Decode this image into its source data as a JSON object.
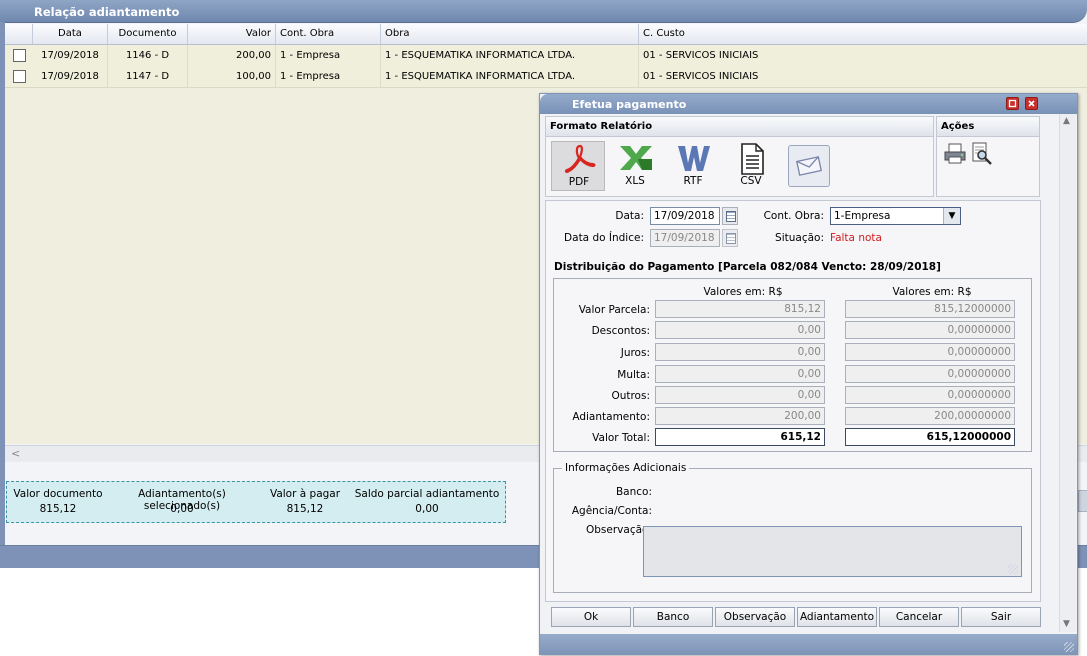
{
  "background_window": {
    "title": "Relação adiantamento",
    "columns": [
      "Data",
      "Documento",
      "Valor",
      "Cont. Obra",
      "Obra",
      "C. Custo"
    ],
    "rows": [
      {
        "data": "17/09/2018",
        "documento": "1146 - D",
        "valor": "200,00",
        "cont_obra": "1 - Empresa",
        "obra": "1 - ESQUEMATIKA INFORMATICA LTDA.",
        "c_custo": "01 - SERVICOS INICIAIS"
      },
      {
        "data": "17/09/2018",
        "documento": "1147 - D",
        "valor": "100,00",
        "cont_obra": "1 - Empresa",
        "obra": "1 - ESQUEMATIKA INFORMATICA LTDA.",
        "c_custo": "01 - SERVICOS INICIAIS"
      }
    ],
    "scroll_left": "<",
    "summary": {
      "valor_documento_label": "Valor documento",
      "valor_documento": "815,12",
      "adiantamentos_label": "Adiantamento(s) selecionado(s)",
      "adiantamentos": "0,00",
      "valor_pagar_label": "Valor à pagar",
      "valor_pagar": "815,12",
      "saldo_label": "Saldo parcial adiantamento",
      "saldo": "0,00"
    }
  },
  "dialog": {
    "title": "Efetua pagamento",
    "formato_relatorio": "Formato Relatório",
    "acoes": "Ações",
    "formats": [
      {
        "label": "PDF",
        "icon": "pdf-icon"
      },
      {
        "label": "XLS",
        "icon": "xls-icon"
      },
      {
        "label": "RTF",
        "icon": "rtf-icon"
      },
      {
        "label": "CSV",
        "icon": "csv-icon"
      }
    ],
    "data_label": "Data:",
    "data_value": "17/09/2018",
    "data_indice_label": "Data do Índice:",
    "data_indice_value": "17/09/2018",
    "cont_obra_label": "Cont. Obra:",
    "cont_obra_value": "1-Empresa",
    "situacao_label": "Situação:",
    "situacao_value": "Falta nota",
    "distribuicao_title": "Distribuição do Pagamento [Parcela 082/084 Vencto: 28/09/2018]",
    "valores_em_1": "Valores em: R$",
    "valores_em_2": "Valores em: R$",
    "lines": [
      {
        "label": "Valor Parcela:",
        "v1": "815,12",
        "v2": "815,12000000"
      },
      {
        "label": "Descontos:",
        "v1": "0,00",
        "v2": "0,00000000"
      },
      {
        "label": "Juros:",
        "v1": "0,00",
        "v2": "0,00000000"
      },
      {
        "label": "Multa:",
        "v1": "0,00",
        "v2": "0,00000000"
      },
      {
        "label": "Outros:",
        "v1": "0,00",
        "v2": "0,00000000"
      },
      {
        "label": "Adiantamento:",
        "v1": "200,00",
        "v2": "200,00000000"
      },
      {
        "label": "Valor Total:",
        "v1": "615,12",
        "v2": "615,12000000"
      }
    ],
    "info_legend": "Informações Adicionais",
    "banco_label": "Banco:",
    "agencia_label": "Agência/Conta:",
    "observacao_label": "Observação:",
    "buttons": [
      "Ok",
      "Banco",
      "Observação",
      "Adiantamento",
      "Cancelar",
      "Sair"
    ]
  },
  "colors": {
    "accent": "#7d92b6",
    "warning_text": "#d21e1e",
    "summary_bg": "#d4edf1"
  }
}
